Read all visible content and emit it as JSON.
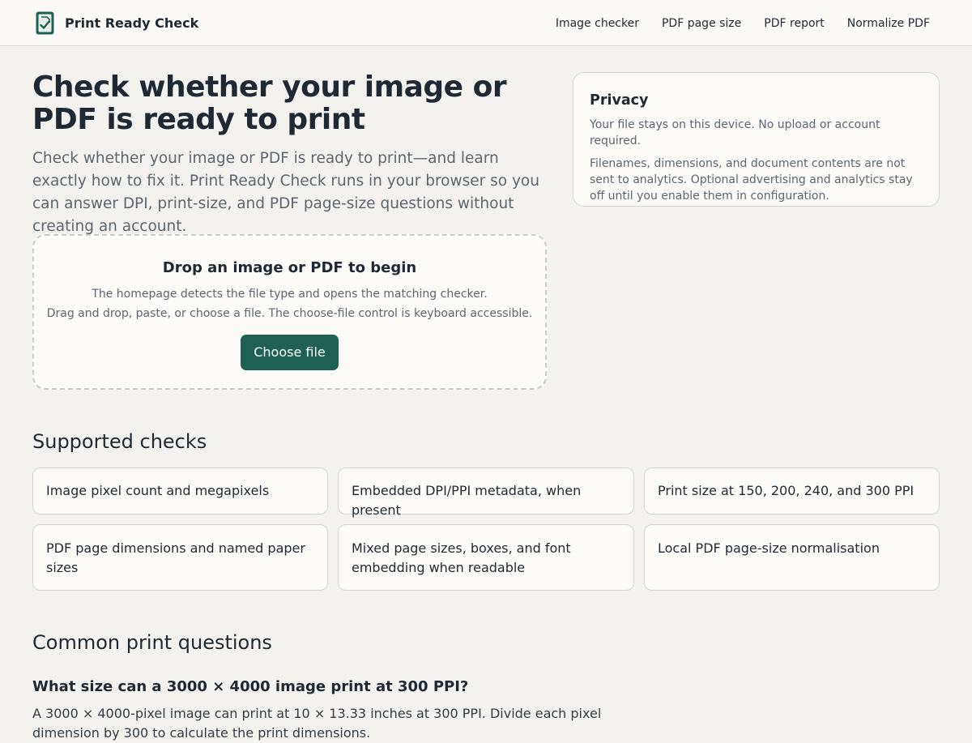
{
  "header": {
    "brand": "Print Ready Check",
    "brand_icon": "document-check-icon",
    "nav": [
      "Image checker",
      "PDF page size",
      "PDF report",
      "Normalize PDF"
    ]
  },
  "hero": {
    "title": "Check whether your image or PDF is ready to print",
    "subtitle": "Check whether your image or PDF is ready to print—and learn exactly how to fix it. Print Ready Check runs in your browser so you can answer DPI, print-size, and PDF page-size questions without creating an account."
  },
  "privacy": {
    "title": "Privacy",
    "p1": "Your file stays on this device. No upload or account required.",
    "p2": "Filenames, dimensions, and document contents are not sent to analytics. Optional advertising and analytics stay off until you enable them in configuration."
  },
  "dropzone": {
    "title": "Drop an image or PDF to begin",
    "line1": "The homepage detects the file type and opens the matching checker.",
    "line2": "Drag and drop, paste, or choose a file. The choose-file control is keyboard accessible.",
    "button": "Choose file"
  },
  "supported": {
    "title": "Supported checks",
    "items": [
      "Image pixel count and megapixels",
      "Embedded DPI/PPI metadata, when present",
      "Print size at 150, 200, 240, and 300 PPI",
      "PDF page dimensions and named paper sizes",
      "Mixed page sizes, boxes, and font embedding when readable",
      "Local PDF page-size normalisation"
    ]
  },
  "faq": {
    "title": "Common print questions",
    "q1": "What size can a 3000 × 4000 image print at 300 PPI?",
    "a1": "A 3000 × 4000-pixel image can print at 10 × 13.33 inches at 300 PPI. Divide each pixel dimension by 300 to calculate the print dimensions."
  },
  "colors": {
    "accent": "#1d6153",
    "background": "#f3f2ee",
    "card": "#fcfbf7"
  }
}
